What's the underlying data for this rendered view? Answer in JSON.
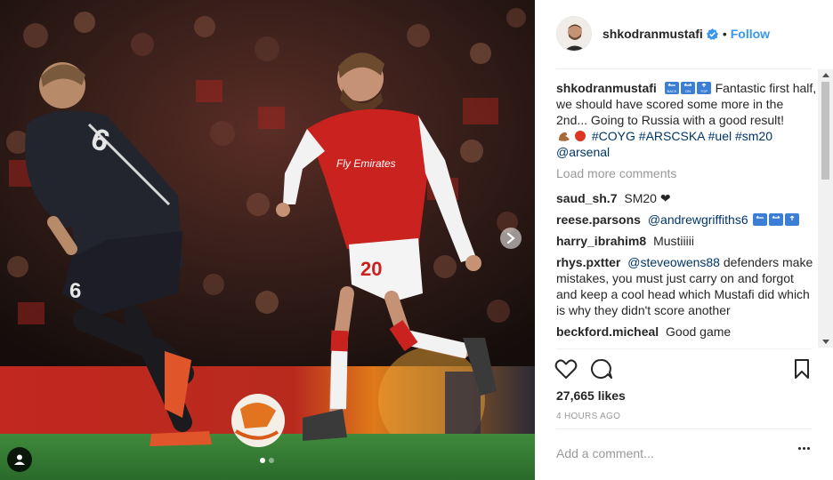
{
  "post": {
    "username": "shkodranmustafi",
    "follow_label": "Follow",
    "separator": "•",
    "caption": {
      "username": "shkodranmustafi",
      "text_1": "Fantastic first half, we should have scored some more in the 2nd... Going to Russia with a good result!",
      "hashtags": [
        "#COYG",
        "#ARSCSKA",
        "#uel",
        "#sm20"
      ],
      "mention": "@arsenal",
      "emoji_text": [
        "BACK",
        "ON",
        "TOP"
      ]
    },
    "load_more_label": "Load more comments",
    "comments": [
      {
        "username": "saud_sh.7",
        "text": "SM20 ❤"
      },
      {
        "username": "reese.parsons",
        "mention": "@andrewgriffiths6",
        "text": ""
      },
      {
        "username": "harry_ibrahim8",
        "text": "Mustiiiii"
      },
      {
        "username": "rhys.pxtter",
        "mention": "@steveowens88",
        "text": "defenders make mistakes, you must just carry on and forgot and keep a cool head which Mustafi did which is why they didn't score another"
      },
      {
        "username": "beckford.micheal",
        "text": "Good game"
      }
    ],
    "likes": "27,665 likes",
    "time": "4 HOURS AGO",
    "add_comment_placeholder": "Add a comment...",
    "carousel": {
      "count": 2,
      "active": 1
    },
    "icons": {
      "like": "heart-icon",
      "comment": "comment-icon",
      "save": "bookmark-icon",
      "verified": "verified-badge-icon",
      "next": "chevron-right-icon",
      "tags": "user-tag-icon",
      "more": "more-options-icon"
    },
    "colors": {
      "link": "#3897f0",
      "hashtag": "#003569",
      "muted": "#999999",
      "arsenal_red": "#d3201f"
    }
  },
  "photo": {
    "shirt_text": "Fly Emirates",
    "number_player": "20",
    "number_opponent": "6"
  }
}
